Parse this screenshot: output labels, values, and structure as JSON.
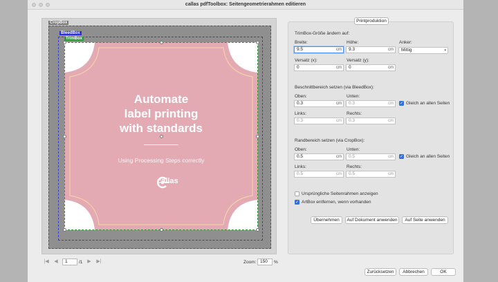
{
  "window": {
    "title": "callas pdfToolbox: Seitengeometrierahmen editieren"
  },
  "preview": {
    "cropbox_label": "CropBox",
    "bleedbox_label": "BleedBox",
    "trimbox_label": "TrimBox",
    "label_title": "Automate label printing with standards",
    "label_title_lines": [
      "Automate",
      "label printing",
      "with standards"
    ],
    "label_subtitle": "Using Processing Steps correctly",
    "label_logo": "callas",
    "colors": {
      "label_fill": "#e3aab3",
      "label_border": "#f3d0a8",
      "crop_bg": "#8f8f8f",
      "bleed": "#2a2ee0",
      "trim": "#2e9a3a"
    }
  },
  "pager": {
    "first": "|◀",
    "prev": "◀",
    "page": "1",
    "total": "/1",
    "next": "▶",
    "last": "▶|",
    "zoom_label": "Zoom:",
    "zoom_value": "150",
    "zoom_unit": "%"
  },
  "panel": {
    "tab": "Printproduktion",
    "trim_section": "TrimBox-Größe ändern auf:",
    "breite_label": "Breite:",
    "breite_value": "9.5",
    "breite_unit": "cm",
    "hoehe_label": "Höhe:",
    "hoehe_value": "9.3",
    "hoehe_unit": "cm",
    "anker_label": "Anker:",
    "anker_value": "Mittig",
    "versatz_x_label": "Versatz (x):",
    "versatz_x_value": "0",
    "versatz_x_unit": "cm",
    "versatz_y_label": "Versatz (y):",
    "versatz_y_value": "0",
    "versatz_y_unit": "cm",
    "bleed_section": "Beschnittbereich setzen (via BleedBox):",
    "bleed_oben_label": "Oben:",
    "bleed_oben_value": "0.3",
    "bleed_oben_unit": "cm",
    "bleed_unten_label": "Unten:",
    "bleed_unten_value": "0.3",
    "bleed_unten_unit": "cm",
    "bleed_links_label": "Links:",
    "bleed_links_value": "0.3",
    "bleed_links_unit": "cm",
    "bleed_rechts_label": "Rechts:",
    "bleed_rechts_value": "0.3",
    "bleed_rechts_unit": "cm",
    "bleed_same_label": "Gleich an allen Seiten",
    "crop_section": "Randbereich setzen (via CropBox):",
    "crop_oben_label": "Oben:",
    "crop_oben_value": "0.5",
    "crop_oben_unit": "cm",
    "crop_unten_label": "Unten:",
    "crop_unten_value": "0.5",
    "crop_unten_unit": "cm",
    "crop_links_label": "Links:",
    "crop_links_value": "0.5",
    "crop_links_unit": "cm",
    "crop_rechts_label": "Rechts:",
    "crop_rechts_value": "0.5",
    "crop_rechts_unit": "cm",
    "crop_same_label": "Gleich an allen Seiten",
    "original_label": "Ursprüngliche Seitenrahmen anzeigen",
    "artbox_label": "ArtBox entfernen, wenn vorhanden",
    "check_mark": "✓",
    "btn_apply": "Übernehmen",
    "btn_apply_doc": "Auf Dokument anwenden",
    "btn_apply_page": "Auf Seite anwenden"
  },
  "footer": {
    "reset": "Zurücksetzen",
    "cancel": "Abbrechen",
    "ok": "OK"
  }
}
